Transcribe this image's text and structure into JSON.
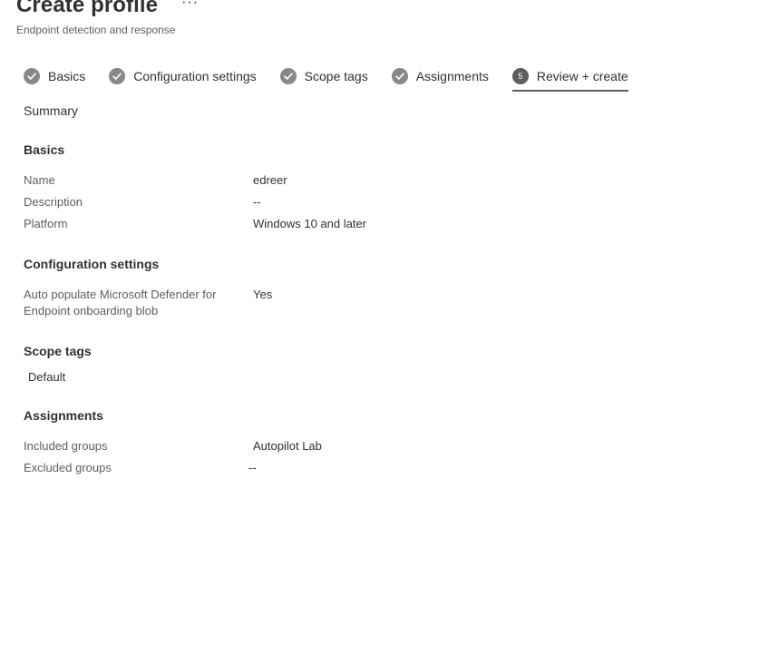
{
  "header": {
    "title": "Create profile",
    "more_label": "···",
    "subtitle": "Endpoint detection and response"
  },
  "steps": [
    {
      "label": "Basics",
      "status": "complete"
    },
    {
      "label": "Configuration settings",
      "status": "complete"
    },
    {
      "label": "Scope tags",
      "status": "complete"
    },
    {
      "label": "Assignments",
      "status": "complete"
    },
    {
      "label": "Review + create",
      "status": "active",
      "number": "5"
    }
  ],
  "summary": {
    "title": "Summary",
    "basics": {
      "title": "Basics",
      "name_label": "Name",
      "name_value": "edreer",
      "description_label": "Description",
      "description_value": "--",
      "platform_label": "Platform",
      "platform_value": "Windows 10 and later"
    },
    "config": {
      "title": "Configuration settings",
      "setting_label_line1": "Auto populate Microsoft Defender for",
      "setting_label_line2": "Endpoint onboarding blob",
      "setting_value": "Yes"
    },
    "scope": {
      "title": "Scope tags",
      "value": "Default"
    },
    "assignments": {
      "title": "Assignments",
      "included_label": "Included groups",
      "included_value": "Autopilot Lab",
      "excluded_label": "Excluded groups",
      "excluded_value": "--"
    }
  },
  "colors": {
    "text": "#323130",
    "muted_text": "#605e5c",
    "check_circle": "#8a8886",
    "active_underline": "#605e5c"
  }
}
